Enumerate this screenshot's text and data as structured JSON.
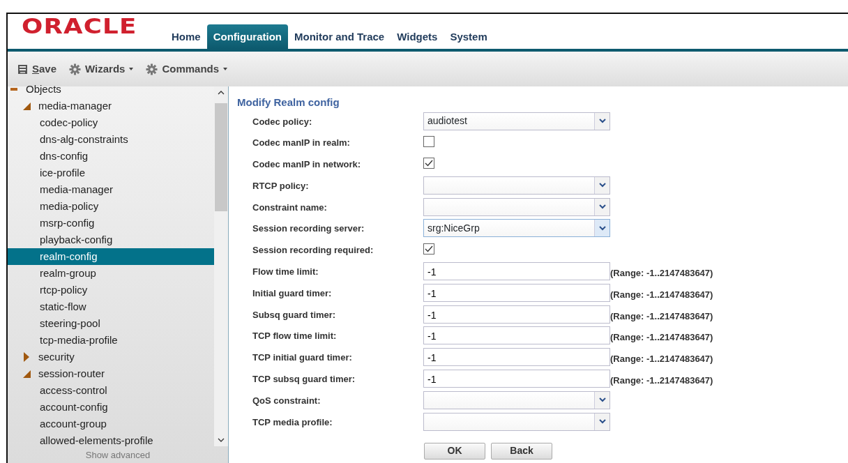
{
  "logo": "ORACLE",
  "nav": [
    {
      "label": "Home",
      "selected": false
    },
    {
      "label": "Configuration",
      "selected": true
    },
    {
      "label": "Monitor and Trace",
      "selected": false
    },
    {
      "label": "Widgets",
      "selected": false
    },
    {
      "label": "System",
      "selected": false
    }
  ],
  "toolbar": [
    {
      "label": "Save",
      "kind": "save",
      "dropdown": false
    },
    {
      "label": "Wizards",
      "kind": "gear",
      "dropdown": true
    },
    {
      "label": "Commands",
      "kind": "gear",
      "dropdown": true
    }
  ],
  "tree": [
    {
      "label": "Objects",
      "expanded": true,
      "selected": false,
      "children": [
        {
          "label": "media-manager",
          "expanded": true,
          "selected": false,
          "children": [
            {
              "label": "codec-policy",
              "selected": false
            },
            {
              "label": "dns-alg-constraints",
              "selected": false
            },
            {
              "label": "dns-config",
              "selected": false
            },
            {
              "label": "ice-profile",
              "selected": false
            },
            {
              "label": "media-manager",
              "selected": false
            },
            {
              "label": "media-policy",
              "selected": false
            },
            {
              "label": "msrp-config",
              "selected": false
            },
            {
              "label": "playback-config",
              "selected": false
            },
            {
              "label": "realm-config",
              "selected": true
            },
            {
              "label": "realm-group",
              "selected": false
            },
            {
              "label": "rtcp-policy",
              "selected": false
            },
            {
              "label": "static-flow",
              "selected": false
            },
            {
              "label": "steering-pool",
              "selected": false
            },
            {
              "label": "tcp-media-profile",
              "selected": false
            }
          ]
        },
        {
          "label": "security",
          "expanded": false,
          "selected": false
        },
        {
          "label": "session-router",
          "expanded": true,
          "selected": false,
          "children": [
            {
              "label": "access-control",
              "selected": false
            },
            {
              "label": "account-config",
              "selected": false
            },
            {
              "label": "account-group",
              "selected": false
            },
            {
              "label": "allowed-elements-profile",
              "selected": false
            }
          ]
        }
      ]
    }
  ],
  "show_advanced": "Show advanced",
  "form": {
    "title": "Modify Realm config",
    "fields": [
      {
        "label": "Codec policy:",
        "kind": "select",
        "value": "audiotest",
        "focused": false
      },
      {
        "label": "Codec manIP in realm:",
        "kind": "checkbox",
        "checked": false
      },
      {
        "label": "Codec manIP in network:",
        "kind": "checkbox",
        "checked": true
      },
      {
        "label": "RTCP policy:",
        "kind": "select",
        "focused": false
      },
      {
        "label": "Constraint name:",
        "kind": "select",
        "focused": false
      },
      {
        "label": "Session recording server:",
        "kind": "select",
        "value": "srg:NiceGrp",
        "focused": true
      },
      {
        "label": "Session recording required:",
        "kind": "checkbox",
        "checked": true
      },
      {
        "label": "Flow time limit:",
        "kind": "text",
        "value": "-1",
        "hint": "(Range: -1..2147483647)"
      },
      {
        "label": "Initial guard timer:",
        "kind": "text",
        "value": "-1",
        "hint": "(Range: -1..2147483647)"
      },
      {
        "label": "Subsq guard timer:",
        "kind": "text",
        "value": "-1",
        "hint": "(Range: -1..2147483647)"
      },
      {
        "label": "TCP flow time limit:",
        "kind": "text",
        "value": "-1",
        "hint": "(Range: -1..2147483647)"
      },
      {
        "label": "TCP initial guard timer:",
        "kind": "text",
        "value": "-1",
        "hint": "(Range: -1..2147483647)"
      },
      {
        "label": "TCP subsq guard timer:",
        "kind": "text",
        "value": "-1",
        "hint": "(Range: -1..2147483647)"
      },
      {
        "label": "QoS constraint:",
        "kind": "select",
        "focused": false
      },
      {
        "label": "TCP media profile:",
        "kind": "select",
        "focused": false
      }
    ],
    "buttons": [
      "OK",
      "Back"
    ]
  }
}
